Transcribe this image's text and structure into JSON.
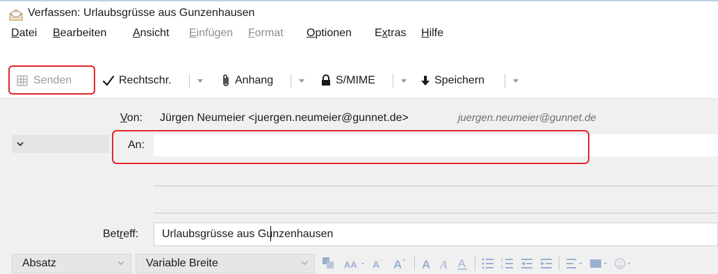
{
  "window": {
    "title": "Verfassen: Urlaubsgrüsse aus Gunzenhausen"
  },
  "menu": [
    {
      "pre": "",
      "key": "D",
      "post": "atei",
      "disabled": false
    },
    {
      "pre": "",
      "key": "B",
      "post": "earbeiten",
      "disabled": false
    },
    {
      "pre": "",
      "key": "A",
      "post": "nsicht",
      "disabled": false
    },
    {
      "pre": "",
      "key": "E",
      "post": "infügen",
      "disabled": true
    },
    {
      "pre": "",
      "key": "F",
      "post": "ormat",
      "disabled": true
    },
    {
      "pre": "",
      "key": "O",
      "post": "ptionen",
      "disabled": false
    },
    {
      "pre": "E",
      "key": "x",
      "post": "tras",
      "disabled": false
    },
    {
      "pre": "",
      "key": "H",
      "post": "ilfe",
      "disabled": false
    }
  ],
  "toolbar": {
    "send_label": "Senden",
    "spell_label": "Rechtschr.",
    "attach_label": "Anhang",
    "smime_label": "S/MIME",
    "save_label": "Speichern"
  },
  "header": {
    "from_label_key": "V",
    "from_label_rest": "on:",
    "from_value": "Jürgen Neumeier <juergen.neumeier@gunnet.de>",
    "from_identity": "juergen.neumeier@gunnet.de",
    "to_label": "An:",
    "to_value": "",
    "subject_label_pre": "Bet",
    "subject_label_key": "r",
    "subject_label_post": "eff:",
    "subject_value": "Urlaubsgrüsse aus Gunzenhausen"
  },
  "format": {
    "paragraph_select": "Absatz",
    "font_select": "Variable Breite"
  },
  "colors": {
    "highlight": "#e2262b",
    "header_bg": "#f0f0f0"
  }
}
